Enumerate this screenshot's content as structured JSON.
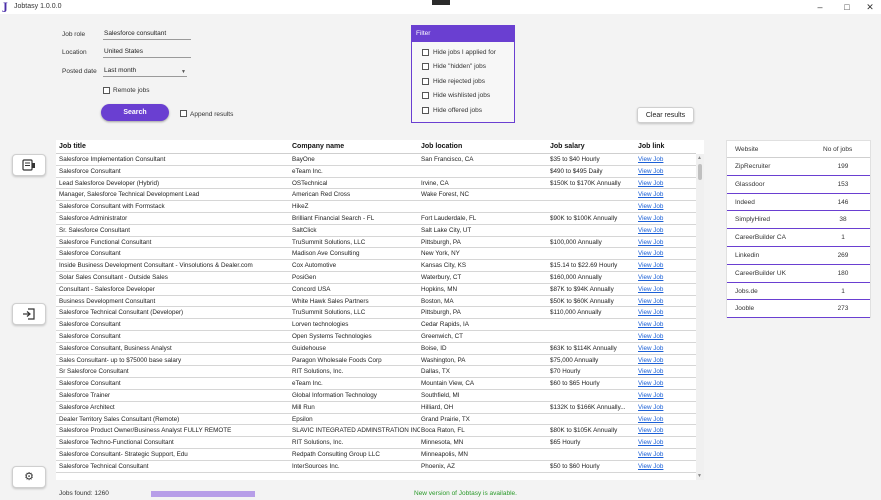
{
  "window": {
    "logo": "J",
    "title": "Jobtasy 1.0.0.0",
    "minimize": "–",
    "maximize": "□",
    "close": "✕"
  },
  "form": {
    "job_role_label": "Job role",
    "job_role_value": "Salesforce consultant",
    "location_label": "Location",
    "location_value": "United States",
    "posted_label": "Posted date",
    "posted_value": "Last month",
    "remote_label": "Remote jobs",
    "search_label": "Search",
    "append_label": "Append results",
    "clear_label": "Clear results"
  },
  "filter": {
    "title": "Filter",
    "options": [
      "Hide jobs I applied for",
      "Hide \"hidden\" jobs",
      "Hide rejected jobs",
      "Hide wishlisted jobs",
      "Hide offered jobs"
    ]
  },
  "side_buttons": {
    "top_icon": "document-icon",
    "middle_icon": "logout-icon",
    "bottom_icon": "gear-icon"
  },
  "table": {
    "headers": {
      "title": "Job title",
      "company": "Company name",
      "location": "Job location",
      "salary": "Job salary",
      "link": "Job link"
    },
    "link_text": "View Job",
    "rows": [
      {
        "title": "Salesforce Implementation Consultant",
        "company": "BayOne",
        "location": "San Francisco, CA",
        "salary": "$35 to $40 Hourly"
      },
      {
        "title": "Salesforce Consultant",
        "company": "eTeam Inc.",
        "location": "",
        "salary": "$490 to $495 Daily"
      },
      {
        "title": "Lead Salesforce Developer (Hybrid)",
        "company": "OSTechnical",
        "location": "Irvine, CA",
        "salary": "$150K to $170K Annually"
      },
      {
        "title": "Manager, Salesforce Technical Development Lead",
        "company": "American Red Cross",
        "location": "Wake Forest, NC",
        "salary": ""
      },
      {
        "title": "Salesforce Consultant with Formstack",
        "company": "HikeZ",
        "location": "",
        "salary": ""
      },
      {
        "title": "Salesforce Administrator",
        "company": "Brilliant Financial Search - FL",
        "location": "Fort Lauderdale, FL",
        "salary": "$90K to $100K Annually"
      },
      {
        "title": "Sr. Salesforce Consultant",
        "company": "SaltClick",
        "location": "Salt Lake City, UT",
        "salary": ""
      },
      {
        "title": "Salesforce Functional Consultant",
        "company": "TruSummit Solutions, LLC",
        "location": "Pittsburgh, PA",
        "salary": "$100,000 Annually"
      },
      {
        "title": "Salesforce Consultant",
        "company": "Madison Ave Consulting",
        "location": "New York, NY",
        "salary": ""
      },
      {
        "title": "Inside Business Development Consultant - Vinsolutions & Dealer.com",
        "company": "Cox Automotive",
        "location": "Kansas City, KS",
        "salary": "$15.14 to $22.69 Hourly"
      },
      {
        "title": "Solar Sales Consultant - Outside Sales",
        "company": "PosiGen",
        "location": "Waterbury, CT",
        "salary": "$160,000 Annually"
      },
      {
        "title": "Consultant - Salesforce Developer",
        "company": "Concord USA",
        "location": "Hopkins, MN",
        "salary": "$87K to $94K Annually"
      },
      {
        "title": "Business Development Consultant",
        "company": "White Hawk Sales Partners",
        "location": "Boston, MA",
        "salary": "$50K to $60K Annually"
      },
      {
        "title": "Salesforce Technical Consultant (Developer)",
        "company": "TruSummit Solutions, LLC",
        "location": "Pittsburgh, PA",
        "salary": "$110,000 Annually"
      },
      {
        "title": "Salesforce Consultant",
        "company": "Lorven technologies",
        "location": "Cedar Rapids, IA",
        "salary": ""
      },
      {
        "title": "Salesforce Consultant",
        "company": "Open Systems Technologies",
        "location": "Greenwich, CT",
        "salary": ""
      },
      {
        "title": "Salesforce Consultant, Business Analyst",
        "company": "Guidehouse",
        "location": "Boise, ID",
        "salary": "$63K to $114K Annually"
      },
      {
        "title": "Sales Consultant- up to $75000 base salary",
        "company": "Paragon Wholesale Foods Corp",
        "location": "Washington, PA",
        "salary": "$75,000 Annually"
      },
      {
        "title": "Sr Salesforce Consultant",
        "company": "RIT Solutions, Inc.",
        "location": "Dallas, TX",
        "salary": "$70 Hourly"
      },
      {
        "title": "Salesforce Consultant",
        "company": "eTeam Inc.",
        "location": "Mountain View, CA",
        "salary": "$60 to $65 Hourly"
      },
      {
        "title": "Salesforce Trainer",
        "company": "Global Information Technology",
        "location": "Southfield, MI",
        "salary": ""
      },
      {
        "title": "Salesforce Architect",
        "company": "Mill Run",
        "location": "Hilliard, OH",
        "salary": "$132K to $166K Annually..."
      },
      {
        "title": "Dealer Territory Sales Consultant (Remote)",
        "company": "Epsilon",
        "location": "Grand Prairie, TX",
        "salary": ""
      },
      {
        "title": "Salesforce Product Owner/Business Analyst FULLY REMOTE",
        "company": "SLAVIC INTEGRATED ADMINSTRATION INC",
        "location": "Boca Raton, FL",
        "salary": "$80K to $105K Annually"
      },
      {
        "title": "Salesforce Techno-Functional Consultant",
        "company": "RIT Solutions, Inc.",
        "location": "Minnesota, MN",
        "salary": "$65 Hourly"
      },
      {
        "title": "Salesforce Consultant- Strategic Support, Edu",
        "company": "Redpath Consulting Group LLC",
        "location": "Minneapolis, MN",
        "salary": ""
      },
      {
        "title": "Salesforce Technical Consultant",
        "company": "InterSources Inc.",
        "location": "Phoenix, AZ",
        "salary": "$50 to $60 Hourly"
      }
    ]
  },
  "stats": {
    "header_site": "Website",
    "header_count": "No of jobs",
    "rows": [
      {
        "site": "ZipRecruiter",
        "count": "199"
      },
      {
        "site": "Glassdoor",
        "count": "153"
      },
      {
        "site": "Indeed",
        "count": "146"
      },
      {
        "site": "SimplyHired",
        "count": "38"
      },
      {
        "site": "CareerBuilder CA",
        "count": "1"
      },
      {
        "site": "Linkedin",
        "count": "269"
      },
      {
        "site": "CareerBuilder UK",
        "count": "180"
      },
      {
        "site": "Jobs.de",
        "count": "1"
      },
      {
        "site": "Jooble",
        "count": "273"
      }
    ]
  },
  "status": {
    "jobs_found": "Jobs found: 1260",
    "progress_fraction": 1.0,
    "message": "New version of Jobtasy is available."
  },
  "colors": {
    "accent": "#6a3fd1",
    "link": "#1a5fd6",
    "status_ok": "#2a9a2a"
  }
}
